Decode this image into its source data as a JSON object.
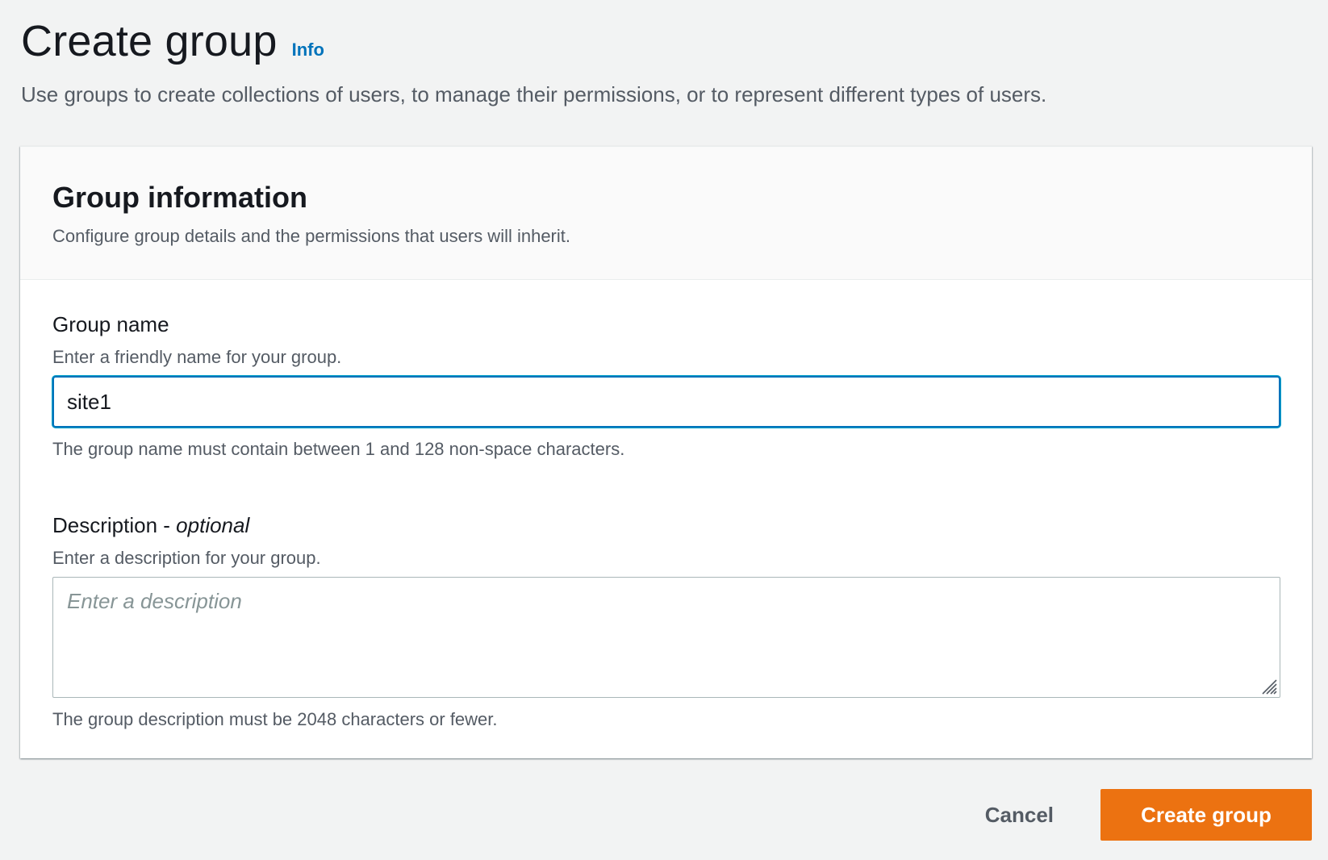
{
  "header": {
    "title": "Create group",
    "info_label": "Info",
    "description": "Use groups to create collections of users, to manage their permissions, or to represent different types of users."
  },
  "group_information": {
    "title": "Group information",
    "subtitle": "Configure group details and the permissions that users will inherit."
  },
  "group_name": {
    "label": "Group name",
    "description": "Enter a friendly name for your group.",
    "value": "site1",
    "constraint": "The group name must contain between 1 and 128 non-space characters."
  },
  "description_field": {
    "label": "Description",
    "label_separator": " - ",
    "optional_label": "optional",
    "description": "Enter a description for your group.",
    "placeholder": "Enter a description",
    "constraint": "The group description must be 2048 characters or fewer."
  },
  "actions": {
    "cancel_label": "Cancel",
    "create_label": "Create group"
  },
  "colors": {
    "primary_button": "#ec7211",
    "link": "#0073bb",
    "focus_border": "#0073bb"
  }
}
